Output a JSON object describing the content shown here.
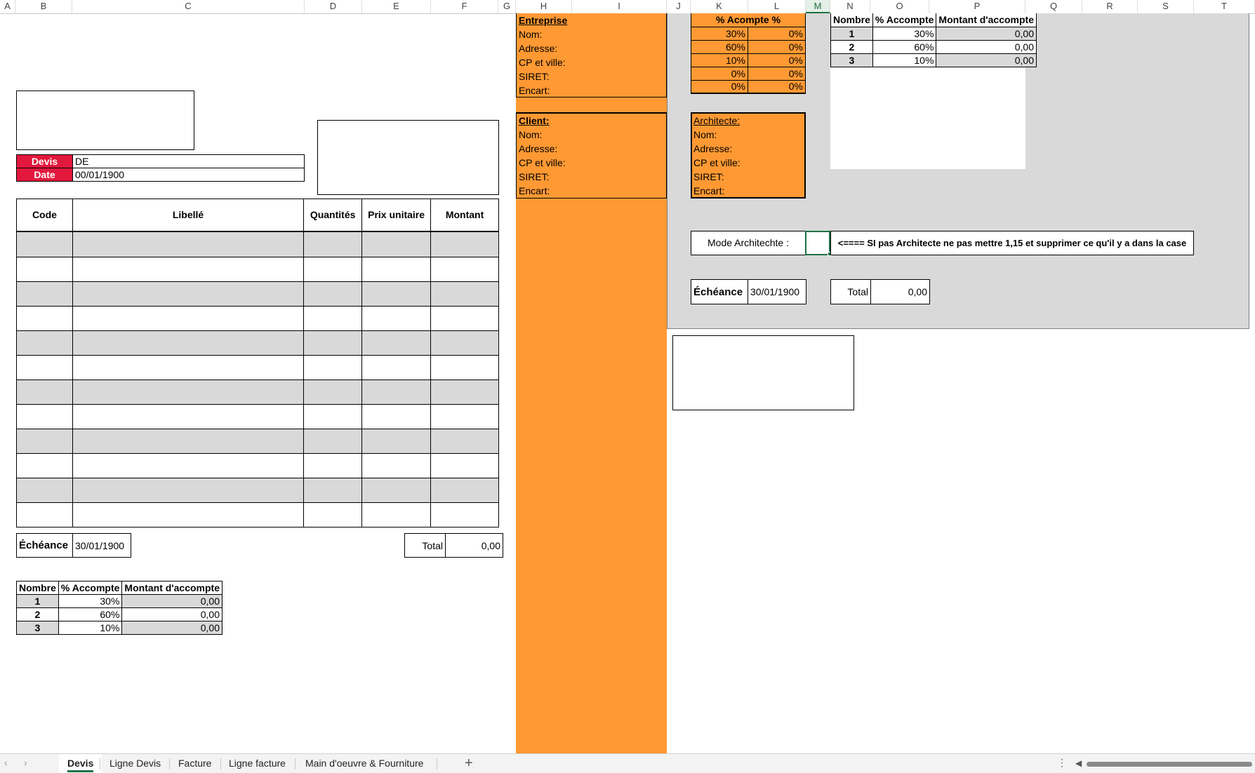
{
  "columns": [
    "A",
    "B",
    "C",
    "D",
    "E",
    "F",
    "G",
    "H",
    "I",
    "J",
    "K",
    "L",
    "M",
    "N",
    "O",
    "P",
    "Q",
    "R",
    "S",
    "T"
  ],
  "colors": {
    "orange": "#ff9933",
    "gray": "#d9d9d9",
    "red": "#e2183c",
    "selection": "#1e7145"
  },
  "quote": {
    "devis_label": "Devis",
    "devis_value": "DE",
    "date_label": "Date",
    "date_value": "00/01/1900",
    "headers": [
      "Code",
      "Libellé",
      "Quantités",
      "Prix unitaire",
      "Montant"
    ],
    "echeance_label": "Échéance",
    "echeance_value": "30/01/1900",
    "total_label": "Total",
    "total_value": "0,00",
    "acompte_headers": [
      "Nombre",
      "% Accompte",
      "Montant d'accompte"
    ],
    "acompte_rows": [
      {
        "n": "1",
        "pct": "30%",
        "amt": "0,00"
      },
      {
        "n": "2",
        "pct": "60%",
        "amt": "0,00"
      },
      {
        "n": "3",
        "pct": "10%",
        "amt": "0,00"
      }
    ]
  },
  "entreprise": {
    "title": "Entreprise",
    "fields": [
      "Nom:",
      "Adresse:",
      "CP et ville:",
      "SIRET:",
      "Encart:"
    ]
  },
  "client": {
    "title": "Client:",
    "fields": [
      "Nom:",
      "Adresse:",
      "CP et ville:",
      "SIRET:",
      "Encart:"
    ]
  },
  "acompte_pct": {
    "header": "% Acompte %",
    "rows": [
      [
        "30%",
        "0%"
      ],
      [
        "60%",
        "0%"
      ],
      [
        "10%",
        "0%"
      ],
      [
        "0%",
        "0%"
      ],
      [
        "0%",
        "0%"
      ]
    ]
  },
  "architecte": {
    "title": "Architecte:",
    "fields": [
      "Nom:",
      "Adresse:",
      "CP et ville:",
      "SIRET:",
      "Encart:"
    ]
  },
  "right_acompte": {
    "headers": [
      "Nombre",
      "% Accompte",
      "Montant d'accompte"
    ],
    "rows": [
      {
        "n": "1",
        "pct": "30%",
        "amt": "0,00"
      },
      {
        "n": "2",
        "pct": "60%",
        "amt": "0,00"
      },
      {
        "n": "3",
        "pct": "10%",
        "amt": "0,00"
      }
    ]
  },
  "mode": {
    "label": "Mode Architechte :",
    "note": "<==== SI pas Architecte ne pas mettre 1,15 et supprimer ce qu'il y a dans la case"
  },
  "right_summary": {
    "echeance_label": "Échéance",
    "echeance_value": "30/01/1900",
    "total_label": "Total",
    "total_value": "0,00"
  },
  "sheet_tabs": [
    "Devis",
    "Ligne Devis",
    "Facture",
    "Ligne facture",
    "Main d'oeuvre & Fourniture"
  ],
  "active_tab": "Devis"
}
